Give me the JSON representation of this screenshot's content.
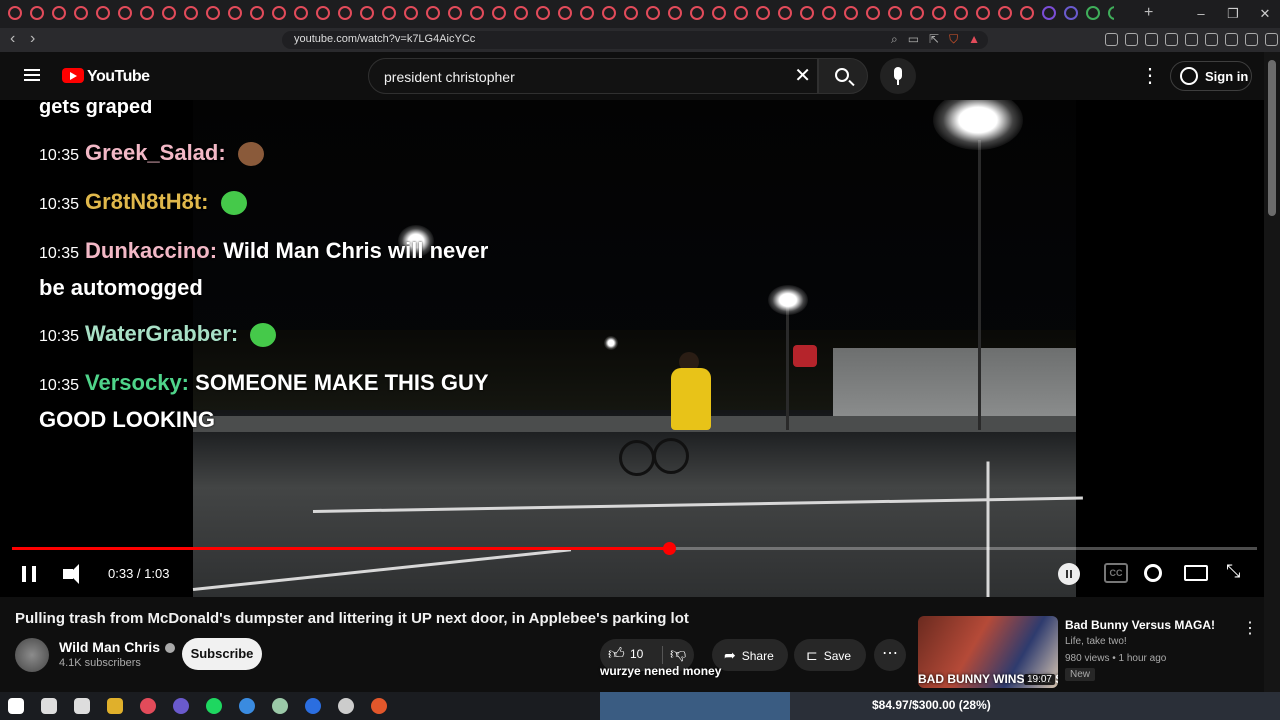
{
  "browser": {
    "url": "youtube.com/watch?v=k7LG4AicYCc",
    "window_controls": [
      "–",
      "❐",
      "✕"
    ],
    "tab_dot_colors": [
      "#e24b5a",
      "#e24b5a",
      "#e24b5a",
      "#e24b5a",
      "#e24b5a",
      "#e24b5a",
      "#e24b5a",
      "#e24b5a",
      "#e24b5a",
      "#e24b5a",
      "#e24b5a",
      "#e24b5a",
      "#e24b5a",
      "#e24b5a",
      "#e24b5a",
      "#e24b5a",
      "#e24b5a",
      "#e24b5a",
      "#e24b5a",
      "#e24b5a",
      "#e24b5a",
      "#e24b5a",
      "#e24b5a",
      "#e24b5a",
      "#e24b5a",
      "#e24b5a",
      "#e24b5a",
      "#e24b5a",
      "#e24b5a",
      "#e24b5a",
      "#e24b5a",
      "#e24b5a",
      "#e24b5a",
      "#e24b5a",
      "#e24b5a",
      "#e24b5a",
      "#e24b5a",
      "#e24b5a",
      "#e24b5a",
      "#e24b5a",
      "#e24b5a",
      "#e24b5a",
      "#e24b5a",
      "#e24b5a",
      "#e24b5a",
      "#e24b5a",
      "#e24b5a",
      "#7b4dd6",
      "#6a5acd",
      "#3fae5a",
      "#3fae5a",
      "#888888",
      "#3a8be0",
      "#e28b2b",
      "#e24b5a",
      "#e24b5a",
      "#888888",
      "#3a8be0",
      "#888888",
      "#3fae5a",
      "#e2c02b",
      "#888888",
      "#3a8be0",
      "#e2c02b",
      "#888888"
    ],
    "new_tab": "+"
  },
  "youtube": {
    "logo_text": "YouTube",
    "search_value": "president christopher",
    "search_clear": "✕",
    "menu_glyph": "⋮",
    "sign_in": "Sign in"
  },
  "overlay": {
    "title": "gets graped",
    "chat": [
      {
        "time": "10:35",
        "user": "Greek_Salad:",
        "user_color": "#f2b8c6",
        "message": "",
        "emote_color": "#8a5a3a"
      },
      {
        "time": "10:35",
        "user": "Gr8tN8tH8t:",
        "user_color": "#e0b84b",
        "message": "",
        "emote_color": "#45c94a"
      },
      {
        "time": "10:35",
        "user": "Dunkaccino:",
        "user_color": "#f2b8c6",
        "message": "Wild Man Chris will never be automogged",
        "emote_color": ""
      },
      {
        "time": "10:35",
        "user": "WaterGrabber:",
        "user_color": "#a8e0c6",
        "message": "",
        "emote_color": "#45c94a"
      },
      {
        "time": "10:35",
        "user": "Versocky:",
        "user_color": "#4fd48a",
        "message": "SOMEONE MAKE THIS GUY GOOD LOOKING",
        "emote_color": ""
      }
    ]
  },
  "player": {
    "time_current": "0:33",
    "time_total": "1:03",
    "time_display": "0:33 / 1:03",
    "progress": 0.528,
    "cc_label": "CC",
    "fullscreen_glyph": "⤡"
  },
  "video": {
    "title": "Pulling trash from McDonald's dumpster and littering it UP next door, in Applebee's parking lot",
    "channel": "Wild Man Chris",
    "subscribers": "4.1K subscribers",
    "subscribe_label": "Subscribe",
    "likes": "10",
    "share_label": "Share",
    "save_label": "Save",
    "more_glyph": "⋯",
    "caption_text": "wurzye nened money"
  },
  "recommendation": {
    "title": "Bad Bunny Versus MAGA!",
    "channel": "Life, take two!",
    "meta": "980 views • 1 hour ago",
    "badge": "New",
    "duration": "19:07",
    "thumb_text": "BAD BUNNY WINS THE SUPERBOWL"
  },
  "taskbar": {
    "icon_colors": [
      "#ffffff",
      "#dddddd",
      "#dddddd",
      "#e0b02b",
      "#e24b5a",
      "#6a5acd",
      "#1ed760",
      "#3a8be0",
      "#9bc9a8",
      "#2b6ee0",
      "#cccccc",
      "#e2572b"
    ],
    "donation_text": "$84.97/$300.00 (28%)",
    "donation_progress": 0.28
  }
}
